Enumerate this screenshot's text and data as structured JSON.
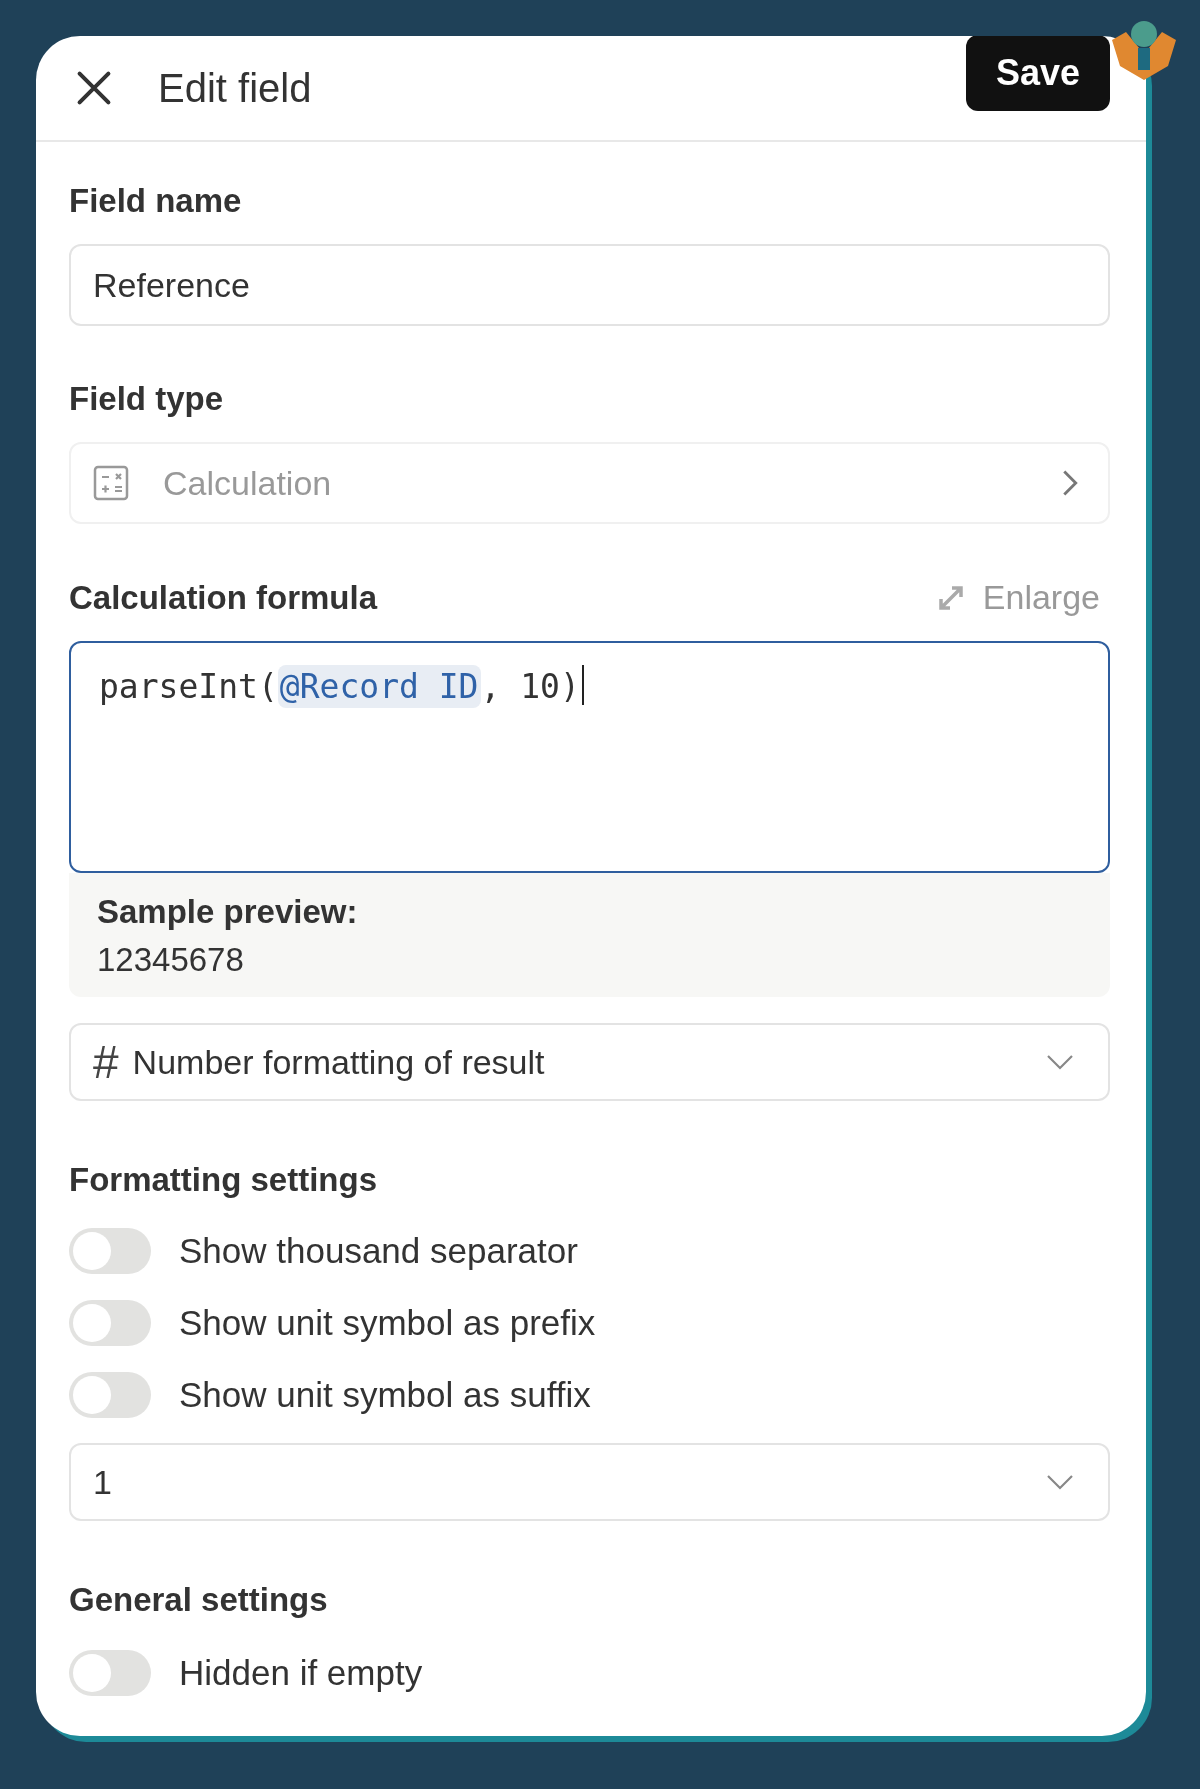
{
  "header": {
    "title": "Edit field",
    "save_button": "Save"
  },
  "field_name": {
    "label": "Field name",
    "value": "Reference"
  },
  "field_type": {
    "label": "Field type",
    "value": "Calculation",
    "disabled": true
  },
  "formula": {
    "label": "Calculation formula",
    "enlarge": "Enlarge",
    "tokens": [
      {
        "kind": "text",
        "text": "parseInt("
      },
      {
        "kind": "reference",
        "text": "@Record ID"
      },
      {
        "kind": "text",
        "text": ", 10)"
      }
    ],
    "preview_label": "Sample preview:",
    "preview_value": "12345678"
  },
  "number_formatting": {
    "icon": "#",
    "label": "Number formatting of result"
  },
  "formatting_settings": {
    "label": "Formatting settings",
    "toggles": [
      {
        "label": "Show thousand separator",
        "on": false
      },
      {
        "label": "Show unit symbol as prefix",
        "on": false
      },
      {
        "label": "Show unit symbol as suffix",
        "on": false
      }
    ],
    "decimals": "1"
  },
  "general_settings": {
    "label": "General settings",
    "toggles": [
      {
        "label": "Hidden if empty",
        "on": false
      }
    ]
  }
}
